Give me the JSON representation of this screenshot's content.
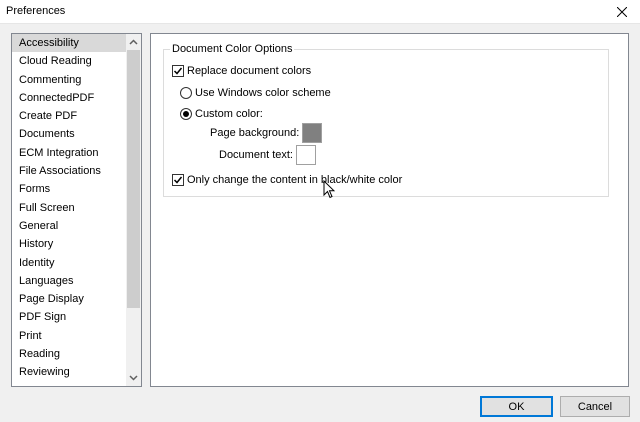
{
  "window": {
    "title": "Preferences"
  },
  "sidebar": {
    "items": [
      "Accessibility",
      "Cloud Reading",
      "Commenting",
      "ConnectedPDF",
      "Create PDF",
      "Documents",
      "ECM Integration",
      "File Associations",
      "Forms",
      "Full Screen",
      "General",
      "History",
      "Identity",
      "Languages",
      "Page Display",
      "PDF Sign",
      "Print",
      "Reading",
      "Reviewing"
    ],
    "selected_index": 0
  },
  "group": {
    "title": "Document Color Options",
    "replace_colors": {
      "label": "Replace document colors",
      "checked": true
    },
    "windows_scheme": {
      "label": "Use Windows color scheme",
      "selected": false
    },
    "custom_color": {
      "label": "Custom color:",
      "selected": true
    },
    "page_background": {
      "label": "Page background:",
      "color": "#808080"
    },
    "document_text": {
      "label": "Document text:",
      "color": "#ffffff"
    },
    "only_change": {
      "label": "Only change the content in black/white color",
      "checked": true
    }
  },
  "buttons": {
    "ok": "OK",
    "cancel": "Cancel"
  },
  "icons": {
    "close": "close-icon",
    "scroll_up": "chevron-up-icon",
    "scroll_down": "chevron-down-icon",
    "checkmark": "checkmark-icon",
    "cursor": "mouse-pointer-icon"
  },
  "colors": {
    "accent": "#0078d7",
    "selection": "#d9d9d9"
  }
}
